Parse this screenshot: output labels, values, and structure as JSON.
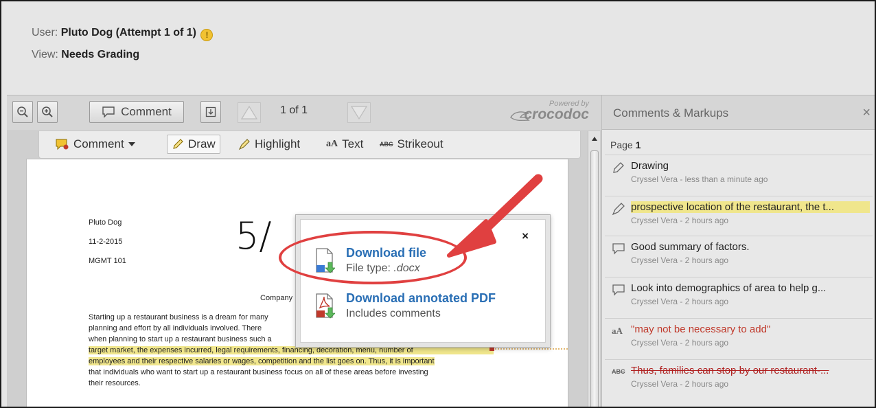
{
  "info": {
    "user_label": "User:",
    "user_value": "Pluto Dog (Attempt 1 of 1)",
    "warning_icon": "!",
    "view_label": "View:",
    "view_value": "Needs Grading"
  },
  "toolbar": {
    "zoom_out_icon": "−",
    "zoom_in_icon": "+",
    "comment_label": "Comment",
    "download_icon": "↓",
    "page_indicator": "1 of 1",
    "powered_by": "Powered by",
    "brand": "crocodoc"
  },
  "subbar": {
    "comment_label": "Comment",
    "draw_label": "Draw",
    "highlight_label": "Highlight",
    "text_icon": "aA",
    "text_label": "Text",
    "strike_icon": "ABC",
    "strike_label": "Strikeout"
  },
  "document": {
    "name": "Pluto Dog",
    "date": "11-2-2015",
    "course": "MGMT 101",
    "grade_mark": "5/",
    "title_fragment": "Company I",
    "lines": [
      "Starting up a restaurant business is a dream for many",
      "planning and effort by all individuals involved.  There",
      "when planning to start up a restaurant business such a",
      "target market, the expenses incurred, legal requirements, financing, decoration, menu, number of",
      "employees and their respective salaries or wages, competition and the list goes on.  Thus, it is important",
      "that individuals who want to start up a restaurant business focus on all of these areas before investing",
      "their resources."
    ]
  },
  "panel": {
    "title": "Comments & Markups",
    "close": "×",
    "page_word": "Page",
    "page_number": "1",
    "comments": [
      {
        "text": "Drawing",
        "meta": "Cryssel Vera - less than a minute ago",
        "icon": "pencil-icon"
      },
      {
        "text": "prospective location of the restaurant, the t...",
        "meta": "Cryssel Vera - 2 hours ago",
        "icon": "highlighter-icon"
      },
      {
        "text": "Good summary of factors.",
        "meta": "Cryssel Vera - 2 hours ago",
        "icon": "speech-bubble-icon"
      },
      {
        "text": "Look into demographics of area to help g...",
        "meta": "Cryssel Vera - 2 hours ago",
        "icon": "speech-bubble-icon"
      },
      {
        "text": "\"may not be necessary to add\"",
        "meta": "Cryssel Vera - 2 hours ago",
        "icon": "text-icon",
        "icon_text": "aA"
      },
      {
        "text": "Thus, families can stop by our restaurant-...",
        "meta": "Cryssel Vera - 2 hours ago",
        "icon": "strikeout-icon",
        "icon_text": "ABC"
      }
    ]
  },
  "popup": {
    "close": "×",
    "download_file": "Download file",
    "file_type_label": "File type:",
    "file_type_value": ".docx",
    "download_pdf": "Download annotated PDF",
    "pdf_subtitle": "Includes comments"
  },
  "colors": {
    "accent_blue": "#2a6fb5",
    "annotation_red": "#e04040",
    "highlight_yellow": "#f0e68c"
  }
}
